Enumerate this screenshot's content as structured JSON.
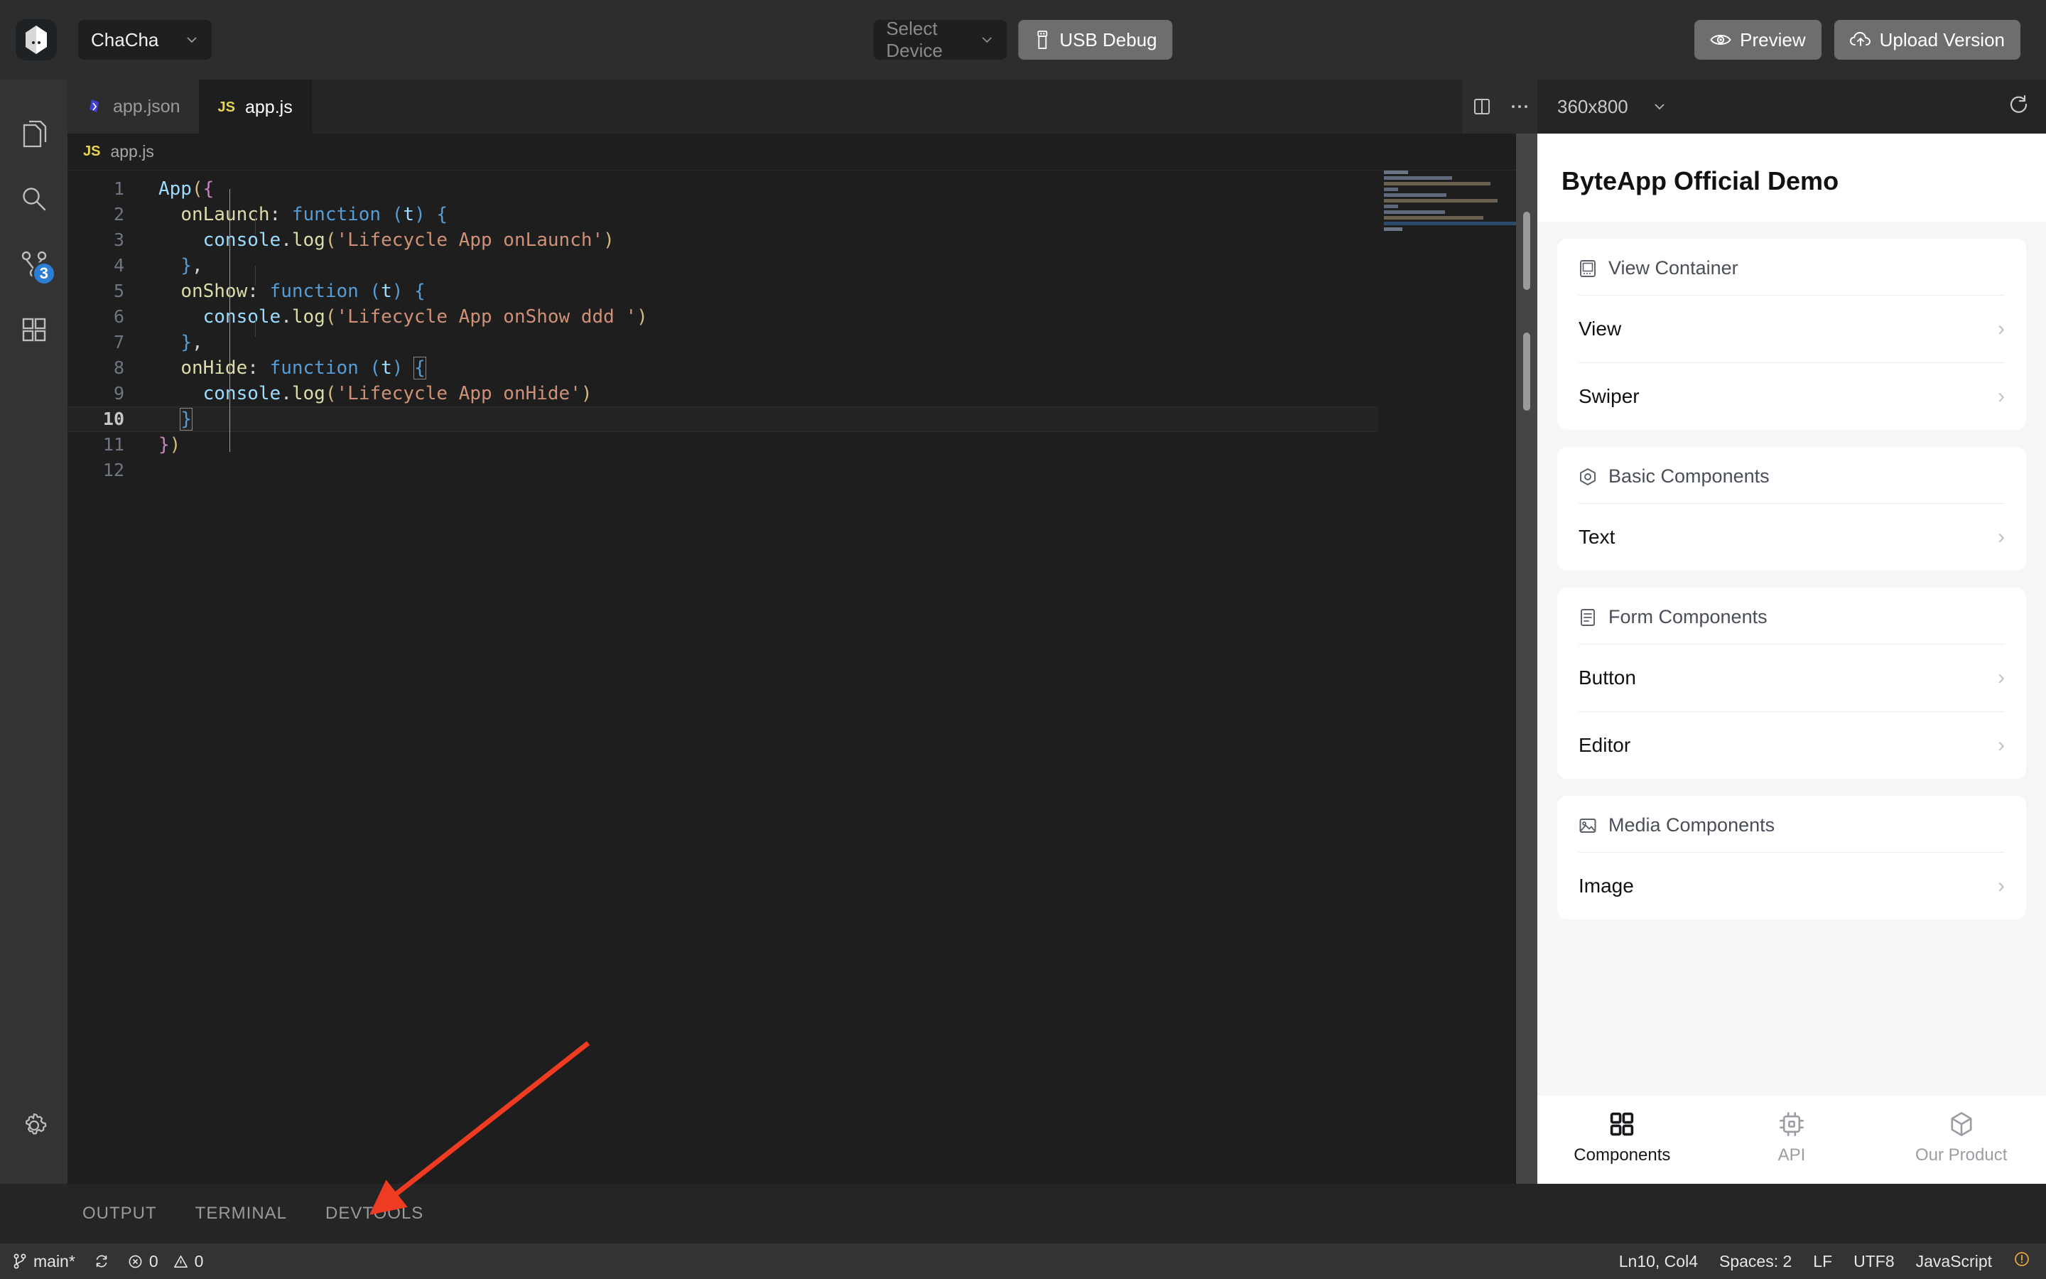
{
  "toolbar": {
    "logo_icon": "byteapp-cube-logo",
    "project_name": "ChaCha",
    "device_placeholder": "Select Device",
    "usb_debug_label": "USB Debug",
    "preview_label": "Preview",
    "upload_label": "Upload Version"
  },
  "activitybar": {
    "items": [
      {
        "icon": "files-explorer-icon",
        "badge": ""
      },
      {
        "icon": "search-icon",
        "badge": ""
      },
      {
        "icon": "source-control-icon",
        "badge": "3"
      },
      {
        "icon": "extensions-icon",
        "badge": ""
      }
    ],
    "settings_icon": "gear-icon"
  },
  "editor": {
    "tabs": [
      {
        "label": "app.json",
        "icon": "json-file-icon",
        "active": false
      },
      {
        "label": "app.js",
        "icon": "js-file-icon",
        "active": true
      }
    ],
    "breadcrumb": {
      "icon": "js-file-icon",
      "label": "app.js"
    },
    "split_icon": "split-editor-icon",
    "more_icon": "more-actions-icon",
    "code": [
      {
        "n": "1",
        "tokens": [
          {
            "t": "App",
            "c": "tk-var"
          },
          {
            "t": "(",
            "c": "tk-y"
          },
          {
            "t": "{",
            "c": "tk-p"
          }
        ]
      },
      {
        "n": "2",
        "tokens": [
          {
            "t": "  ",
            "c": "tk-plain"
          },
          {
            "t": "onLaunch",
            "c": "tk-key"
          },
          {
            "t": ": ",
            "c": "tk-plain"
          },
          {
            "t": "function",
            "c": "tk-fn"
          },
          {
            "t": " (",
            "c": "tk-b"
          },
          {
            "t": "t",
            "c": "tk-var"
          },
          {
            "t": ")",
            "c": "tk-b"
          },
          {
            "t": " ",
            "c": "tk-plain"
          },
          {
            "t": "{",
            "c": "tk-b"
          }
        ]
      },
      {
        "n": "3",
        "tokens": [
          {
            "t": "    ",
            "c": "tk-plain"
          },
          {
            "t": "console",
            "c": "tk-def"
          },
          {
            "t": ".",
            "c": "tk-plain"
          },
          {
            "t": "log",
            "c": "tk-key"
          },
          {
            "t": "(",
            "c": "tk-y"
          },
          {
            "t": "'Lifecycle App onLaunch'",
            "c": "tk-str"
          },
          {
            "t": ")",
            "c": "tk-y"
          }
        ]
      },
      {
        "n": "4",
        "tokens": [
          {
            "t": "  ",
            "c": "tk-plain"
          },
          {
            "t": "}",
            "c": "tk-b"
          },
          {
            "t": ",",
            "c": "tk-plain"
          }
        ]
      },
      {
        "n": "5",
        "tokens": [
          {
            "t": "  ",
            "c": "tk-plain"
          },
          {
            "t": "onShow",
            "c": "tk-key"
          },
          {
            "t": ": ",
            "c": "tk-plain"
          },
          {
            "t": "function",
            "c": "tk-fn"
          },
          {
            "t": " (",
            "c": "tk-b"
          },
          {
            "t": "t",
            "c": "tk-var"
          },
          {
            "t": ")",
            "c": "tk-b"
          },
          {
            "t": " ",
            "c": "tk-plain"
          },
          {
            "t": "{",
            "c": "tk-b"
          }
        ]
      },
      {
        "n": "6",
        "tokens": [
          {
            "t": "    ",
            "c": "tk-plain"
          },
          {
            "t": "console",
            "c": "tk-def"
          },
          {
            "t": ".",
            "c": "tk-plain"
          },
          {
            "t": "log",
            "c": "tk-key"
          },
          {
            "t": "(",
            "c": "tk-y"
          },
          {
            "t": "'Lifecycle App onShow ddd '",
            "c": "tk-str"
          },
          {
            "t": ")",
            "c": "tk-y"
          }
        ]
      },
      {
        "n": "7",
        "tokens": [
          {
            "t": "  ",
            "c": "tk-plain"
          },
          {
            "t": "}",
            "c": "tk-b"
          },
          {
            "t": ",",
            "c": "tk-plain"
          }
        ]
      },
      {
        "n": "8",
        "tokens": [
          {
            "t": "  ",
            "c": "tk-plain"
          },
          {
            "t": "onHide",
            "c": "tk-key"
          },
          {
            "t": ": ",
            "c": "tk-plain"
          },
          {
            "t": "function",
            "c": "tk-fn"
          },
          {
            "t": " (",
            "c": "tk-b"
          },
          {
            "t": "t",
            "c": "tk-var"
          },
          {
            "t": ")",
            "c": "tk-b"
          },
          {
            "t": " ",
            "c": "tk-plain"
          },
          {
            "t": "{",
            "c": "tk-b brmatch"
          }
        ]
      },
      {
        "n": "9",
        "tokens": [
          {
            "t": "    ",
            "c": "tk-plain"
          },
          {
            "t": "console",
            "c": "tk-def"
          },
          {
            "t": ".",
            "c": "tk-plain"
          },
          {
            "t": "log",
            "c": "tk-key"
          },
          {
            "t": "(",
            "c": "tk-y"
          },
          {
            "t": "'Lifecycle App onHide'",
            "c": "tk-str"
          },
          {
            "t": ")",
            "c": "tk-y"
          }
        ]
      },
      {
        "n": "10",
        "current": true,
        "tokens": [
          {
            "t": "  ",
            "c": "tk-plain"
          },
          {
            "t": "}",
            "c": "tk-b brmatch"
          }
        ]
      },
      {
        "n": "11",
        "tokens": [
          {
            "t": "}",
            "c": "tk-p"
          },
          {
            "t": ")",
            "c": "tk-y"
          }
        ]
      },
      {
        "n": "12",
        "tokens": []
      }
    ]
  },
  "simulator": {
    "split_icon": "split-panel-icon",
    "more_icon": "more-actions-icon",
    "resolution": "360x800",
    "refresh_icon": "refresh-icon",
    "page_title": "ByteApp Official Demo",
    "sections": [
      {
        "icon": "view-container-icon",
        "title": "View Container",
        "rows": [
          "View",
          "Swiper"
        ]
      },
      {
        "icon": "basic-components-icon",
        "title": "Basic Components",
        "rows": [
          "Text"
        ]
      },
      {
        "icon": "form-components-icon",
        "title": "Form Components",
        "rows": [
          "Button",
          "Editor"
        ]
      },
      {
        "icon": "media-components-icon",
        "title": "Media Components",
        "rows": [
          "Image"
        ]
      }
    ],
    "tabbar": [
      {
        "label": "Components",
        "icon": "grid-icon",
        "active": true
      },
      {
        "label": "API",
        "icon": "chip-icon",
        "active": false
      },
      {
        "label": "Our Product",
        "icon": "hexagon-cube-icon",
        "active": false
      }
    ]
  },
  "panel": {
    "tabs": [
      "OUTPUT",
      "TERMINAL",
      "DEVTOOLS"
    ]
  },
  "statusbar": {
    "branch_icon": "source-control-branch-icon",
    "branch": "main*",
    "sync_icon": "sync-icon",
    "error_icon": "error-circle-icon",
    "errors": "0",
    "warning_icon": "warning-triangle-icon",
    "warnings": "0",
    "cursor": "Ln10, Col4",
    "spaces": "Spaces: 2",
    "eol": "LF",
    "encoding": "UTF8",
    "language": "JavaScript",
    "notify_icon": "bell-alert-icon"
  },
  "annotation": {
    "arrow_color": "#ef3b21"
  }
}
